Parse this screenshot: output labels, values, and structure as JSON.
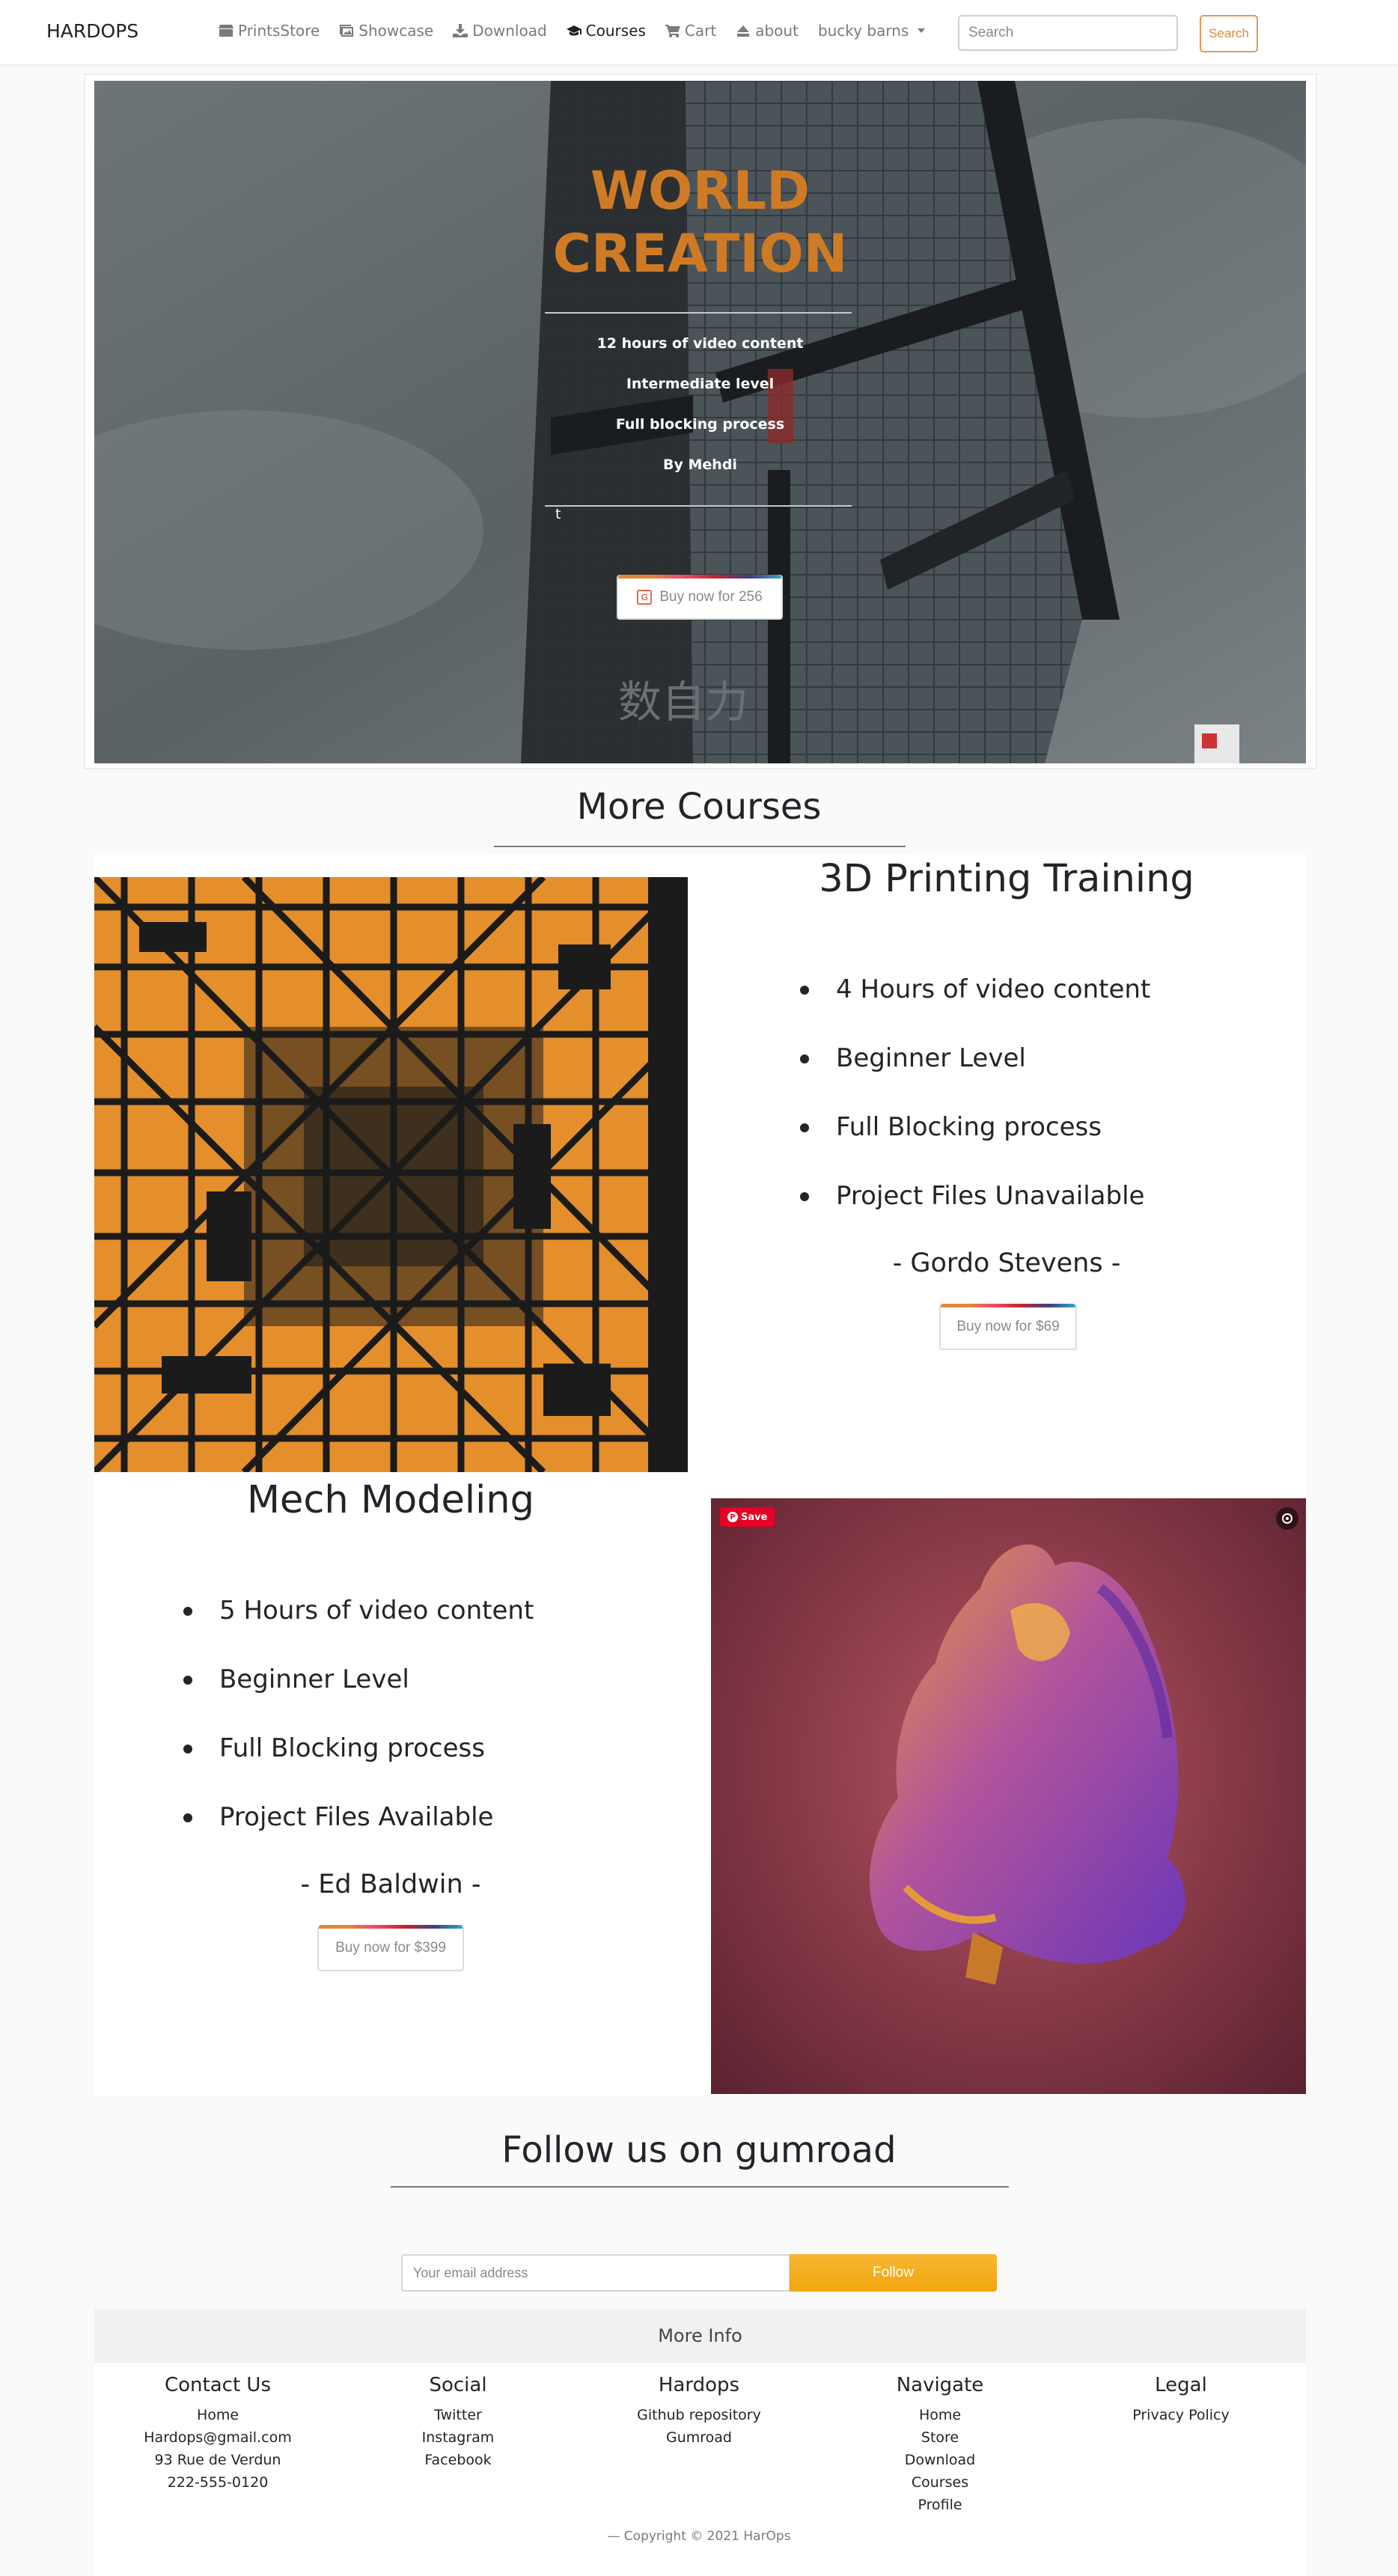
{
  "navbar": {
    "brand": "HARDOPS",
    "items": [
      {
        "label": "PrintsStore",
        "icon": "store-icon"
      },
      {
        "label": "Showcase",
        "icon": "images-icon"
      },
      {
        "label": "Download",
        "icon": "download-icon"
      },
      {
        "label": "Courses",
        "icon": "graduation-cap-icon",
        "active": true
      },
      {
        "label": "Cart",
        "icon": "cart-icon"
      },
      {
        "label": "about",
        "icon": "eject-icon"
      }
    ],
    "user_menu": "bucky barns",
    "search_placeholder": "Search",
    "search_button": "Search"
  },
  "hero": {
    "title_line1": "WORLD",
    "title_line2": "CREATION",
    "lines": [
      "12 hours of video content",
      "Intermediate level",
      "Full blocking process",
      "By Mehdi"
    ],
    "extra": "t",
    "buy_button": "Buy now for 256",
    "sign_text": "数自力"
  },
  "more_courses": {
    "title": "More Courses",
    "courses": [
      {
        "title": "3D Printing Training",
        "bullets": [
          "4 Hours of video content",
          "Beginner Level",
          "Full Blocking process",
          "Project Files Unavailable"
        ],
        "author": "- Gordo Stevens -",
        "buy_button": "Buy now for $69"
      },
      {
        "title": "Mech Modeling",
        "bullets": [
          "5 Hours of video content",
          "Beginner Level",
          "Full Blocking process",
          "Project Files Available"
        ],
        "author": "- Ed Baldwin -",
        "buy_button": "Buy now for $399"
      }
    ],
    "pin_save": "Save"
  },
  "follow": {
    "title": "Follow us on gumroad",
    "email_placeholder": "Your email address",
    "button": "Follow"
  },
  "footer": {
    "title": "More Info",
    "columns": [
      {
        "heading": "Contact Us",
        "links": [
          "Home",
          "Hardops@gmail.com",
          "93 Rue de Verdun",
          "222-555-0120"
        ]
      },
      {
        "heading": "Social",
        "links": [
          "Twitter",
          "Instagram",
          "Facebook"
        ]
      },
      {
        "heading": "Hardops",
        "links": [
          "Github repository",
          "Gumroad"
        ]
      },
      {
        "heading": "Navigate",
        "links": [
          "Home",
          "Store",
          "Download",
          "Courses",
          "Profile"
        ]
      },
      {
        "heading": "Legal",
        "links": [
          "Privacy Policy"
        ]
      }
    ],
    "copyright": "— Copyright © 2021 HarOps"
  },
  "colors": {
    "accent_orange": "#cf7b26",
    "follow_button": "#f2a50f",
    "pinterest_red": "#e60023"
  }
}
